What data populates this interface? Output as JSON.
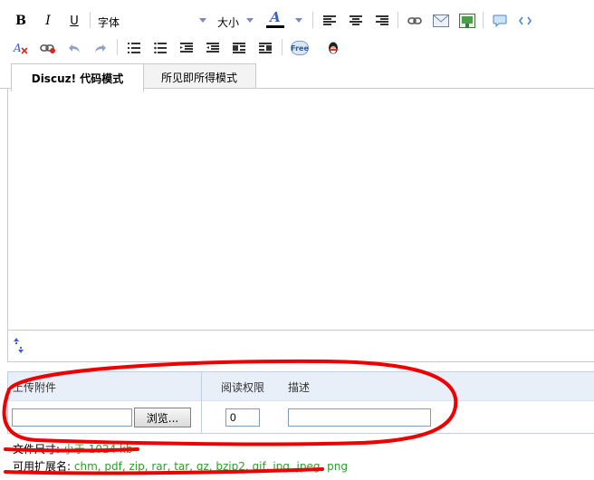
{
  "toolbar": {
    "bold": "B",
    "italic": "I",
    "underline": "U",
    "font_label": "字体",
    "size_label": "大小",
    "font_color_glyph": "A",
    "free_badge": "Free"
  },
  "tabs": [
    {
      "label": "Discuz! 代码模式",
      "active": true
    },
    {
      "label": "所见即所得模式",
      "active": false
    }
  ],
  "attachment": {
    "col_upload": "上传附件",
    "col_permission": "阅读权限",
    "col_description": "描述",
    "browse_label": "浏览...",
    "permission_value": "0",
    "file_value": "",
    "description_value": ""
  },
  "info": {
    "size_label": "文件尺寸:",
    "size_value": "小于 1024 kb",
    "ext_label": "可用扩展名:",
    "ext_value": "chm, pdf, zip, rar, tar, gz, bzip2, gif, jpg, jpeg, png"
  },
  "colors": {
    "annotation_red": "#ee0000",
    "info_green": "#2a9e2a",
    "header_blue": "#e8eff8"
  }
}
